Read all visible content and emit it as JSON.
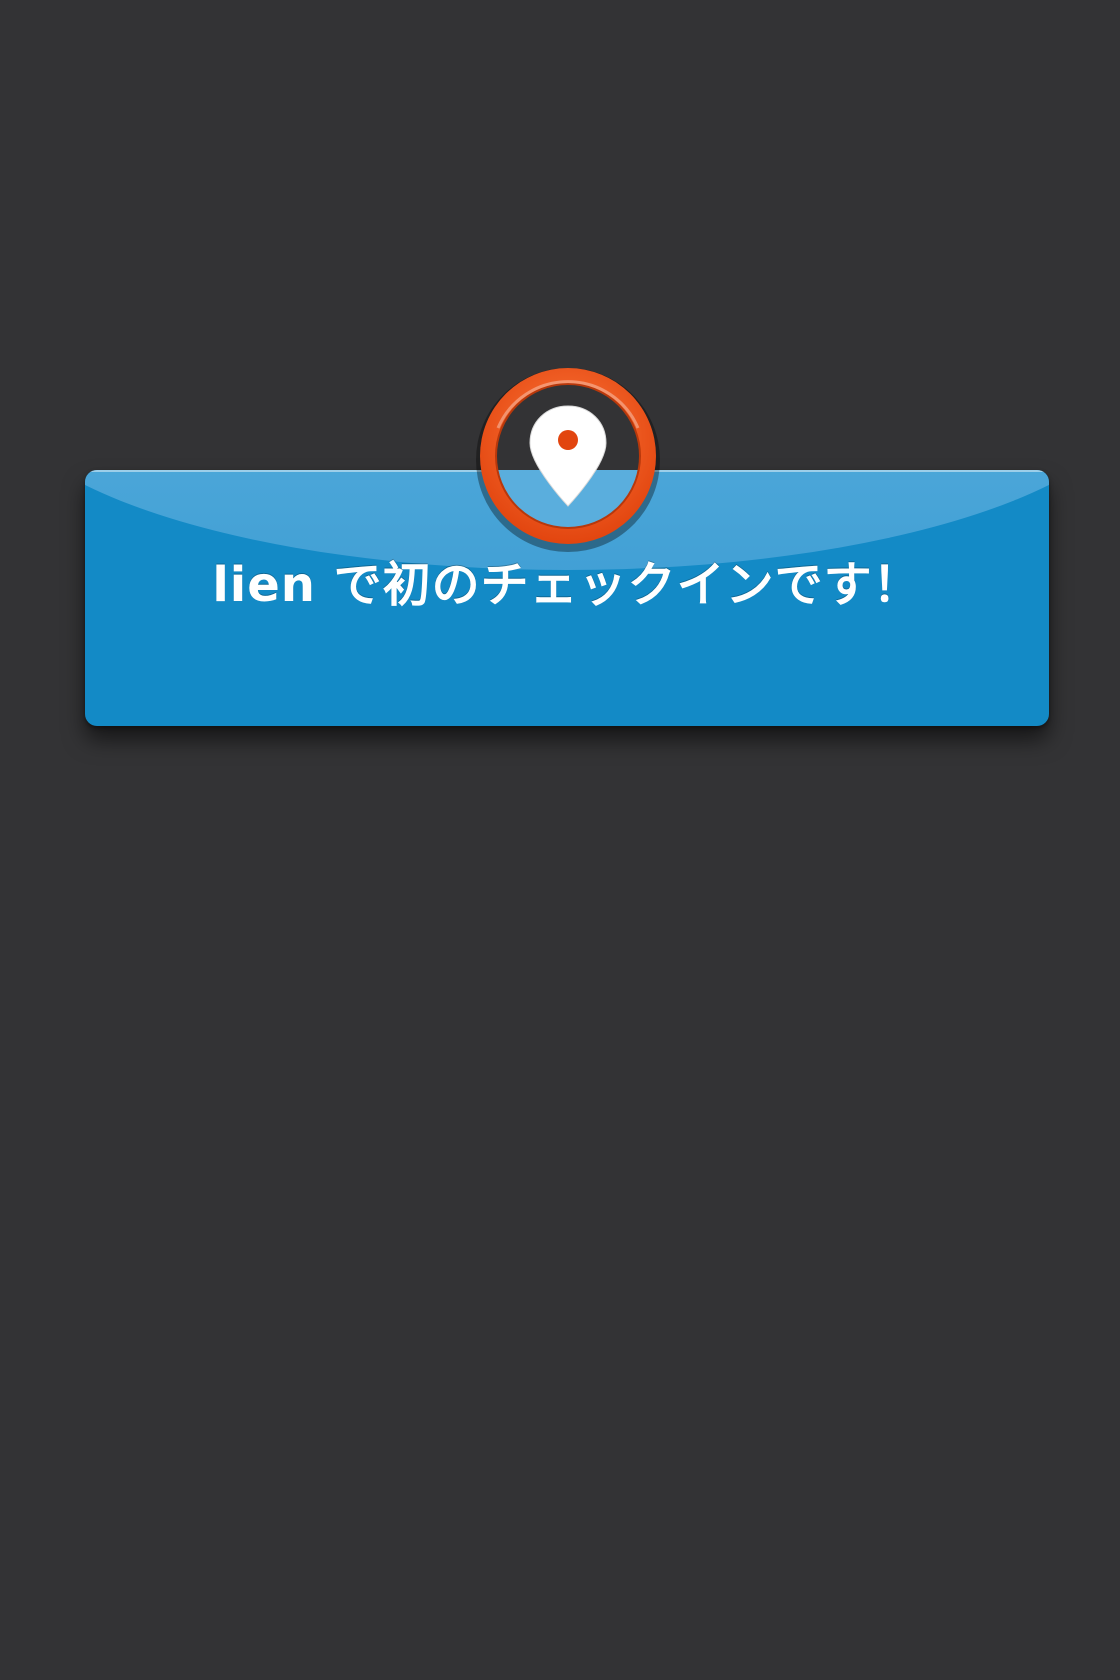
{
  "notification": {
    "message": "lien で初のチェックインです！",
    "icon": "location-pin-icon",
    "colors": {
      "background": "#333335",
      "banner": "#138ac6",
      "badge_ring": "#f0561c",
      "pin": "#ffffff"
    }
  }
}
